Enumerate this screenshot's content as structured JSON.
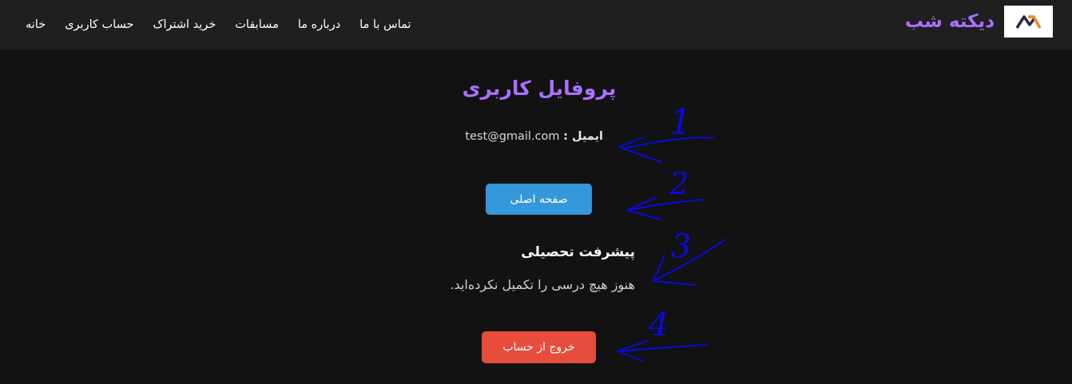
{
  "header": {
    "brand_name": "دیکته شب",
    "nav_items": [
      {
        "label": "خانه"
      },
      {
        "label": "حساب کاربری"
      },
      {
        "label": "خرید اشتراک"
      },
      {
        "label": "مسابقات"
      },
      {
        "label": "درباره ما"
      },
      {
        "label": "تماس با ما"
      }
    ]
  },
  "main": {
    "title": "پروفایل کاربری",
    "email_label": "ایمیل :",
    "email_value": "test@gmail.com",
    "home_button": "صفحه اصلی",
    "progress_heading": "پیشرفت تحصیلی",
    "progress_text": "هنوز هیچ درسی را تکمیل نکرده‌اید.",
    "logout_button": "خروج از حساب"
  },
  "annotations": {
    "numbers": [
      "1",
      "2",
      "3",
      "4"
    ],
    "color": "#0a0adc"
  },
  "colors": {
    "accent": "#a970ff",
    "home_button": "#3498db",
    "logout_button": "#e74c3c"
  }
}
